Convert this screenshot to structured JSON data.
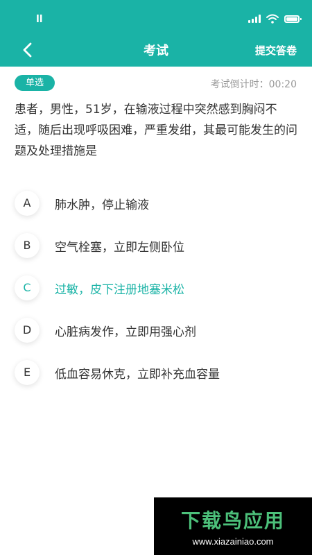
{
  "status_bar": {
    "left_text": "ll",
    "signal_icon": "signal-bars-icon",
    "wifi_icon": "wifi-icon",
    "battery_icon": "battery-icon"
  },
  "header": {
    "back_icon": "chevron-left-icon",
    "title": "考试",
    "submit_label": "提交答卷"
  },
  "question": {
    "type_label": "单选",
    "countdown_label": "考试倒计时：00:20",
    "text": "患者，男性，51岁，在输液过程中突然感到胸闷不适，随后出现呼吸困难，严重发绀，其最可能发生的问题及处理措施是",
    "selected": "C",
    "options": [
      {
        "letter": "A",
        "text": "肺水肿，停止输液"
      },
      {
        "letter": "B",
        "text": "空气栓塞，立即左侧卧位"
      },
      {
        "letter": "C",
        "text": "过敏，皮下注册地塞米松"
      },
      {
        "letter": "D",
        "text": "心脏病发作，立即用强心剂"
      },
      {
        "letter": "E",
        "text": "低血容易休克，立即补充血容量"
      }
    ]
  },
  "watermark": {
    "logo_text": "下载鸟应用",
    "url": "www.xiazainiao.com"
  },
  "colors": {
    "accent": "#1ab3a6",
    "text": "#333333",
    "muted": "#999999"
  }
}
